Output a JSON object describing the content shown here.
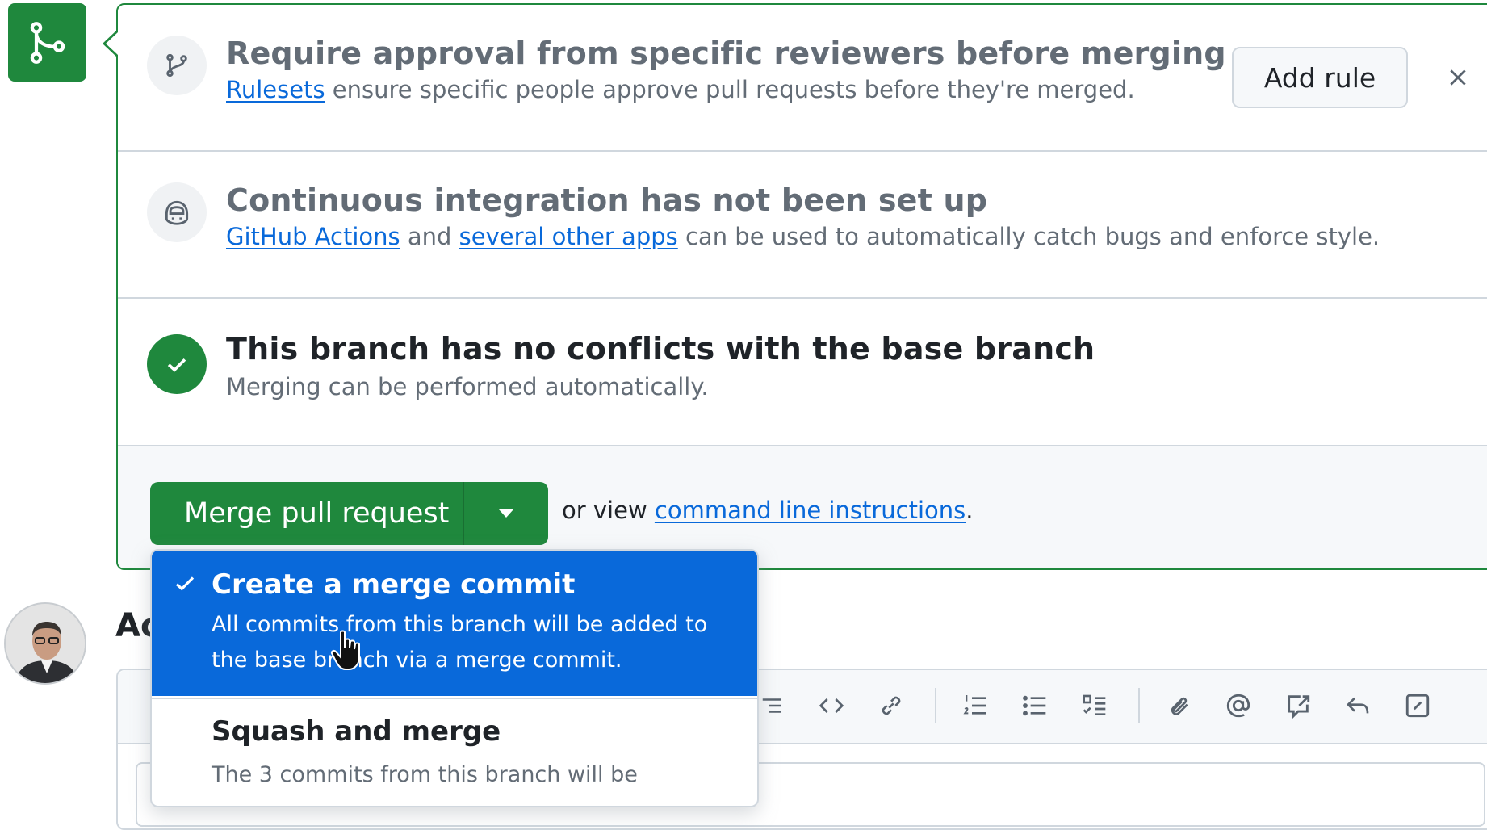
{
  "rules_section": {
    "title": "Require approval from specific reviewers before merging",
    "link_text": "Rulesets",
    "desc_rest": " ensure specific people approve pull requests before they're merged.",
    "add_rule_label": "Add rule",
    "close_label": "×"
  },
  "ci_section": {
    "title": "Continuous integration has not been set up",
    "link1_text": "GitHub Actions",
    "mid_text": " and ",
    "link2_text": "several other apps",
    "desc_rest": " can be used to automatically catch bugs and enforce style."
  },
  "conflict_section": {
    "title": "This branch has no conflicts with the base branch",
    "desc": "Merging can be performed automatically."
  },
  "merge_actions": {
    "merge_button_label": "Merge pull request",
    "or_view_text": "or view ",
    "instructions_link": "command line instructions",
    "period": "."
  },
  "merge_menu": {
    "options": [
      {
        "title": "Create a merge commit",
        "desc": "All commits from this branch will be added to the base branch via a merge commit.",
        "selected": true
      },
      {
        "title": "Squash and merge",
        "desc": "The 3 commits from this branch will be",
        "selected": false
      }
    ]
  },
  "activity": {
    "heading": "Ac"
  },
  "colors": {
    "success": "#1f883d",
    "accent": "#0969da",
    "muted": "#636c76",
    "border": "#d0d7de"
  },
  "icons": {
    "branch_badge": "git-merge-icon",
    "rules": "git-branch-icon",
    "ci": "copilot-robot-icon",
    "conflict": "check-circle-icon"
  }
}
